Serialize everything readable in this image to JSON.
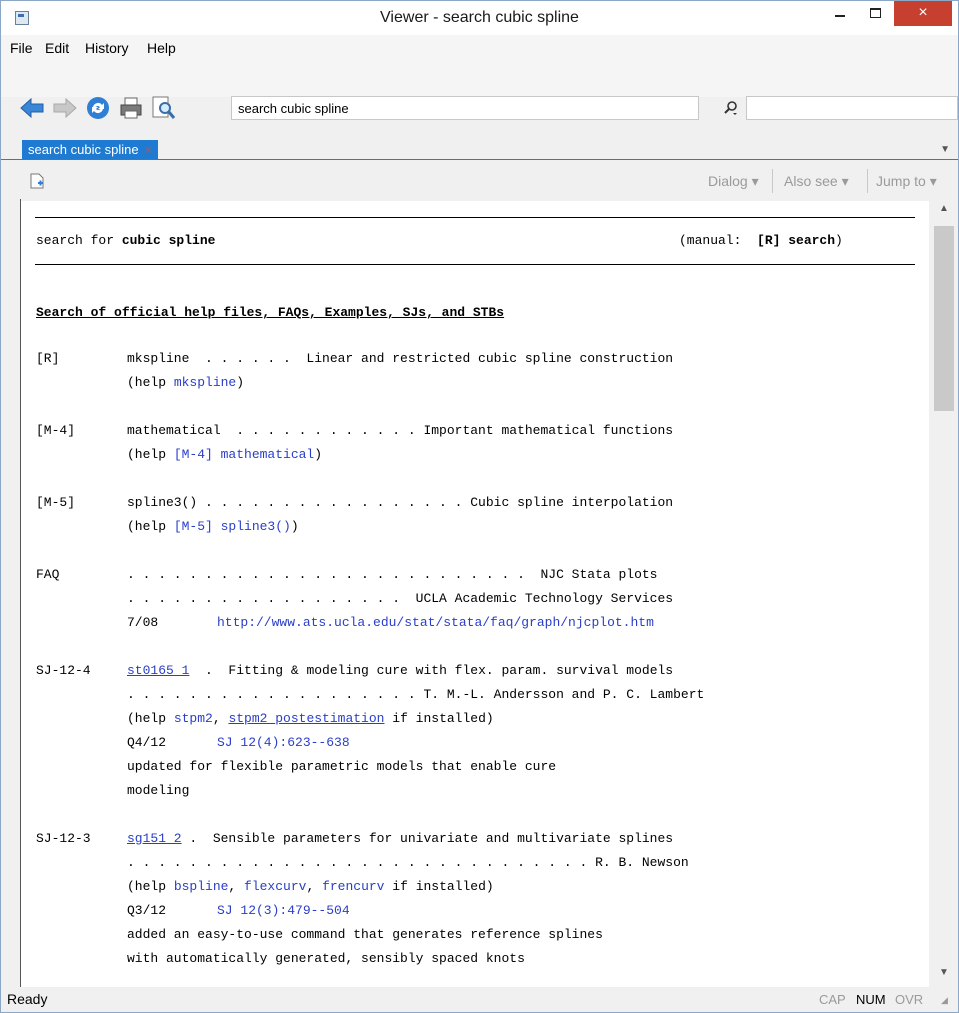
{
  "window": {
    "title": "Viewer - search cubic spline",
    "close_glyph": "×"
  },
  "menu": [
    "File",
    "Edit",
    "History",
    "Help"
  ],
  "toolbar": {
    "search_value": "search cubic spline",
    "find_value": ""
  },
  "tab": {
    "label": "search cubic spline",
    "close_glyph": "×"
  },
  "viewer_toolbar": {
    "dialog": "Dialog ▾",
    "also_see": "Also see ▾",
    "jump_to": "Jump to ▾"
  },
  "content": {
    "header_left": "search for ",
    "header_term": "cubic spline",
    "header_right": "(manual:  [R] search)",
    "section_title": "Search of official help files, FAQs, Examples, SJs, and STBs",
    "entries": {
      "mkspline": {
        "tag": "[R]",
        "line1": "mkspline  . . . . . .  Linear and restricted cubic spline construction",
        "help_prefix": "(help ",
        "help_link": "mkspline",
        "help_suffix": ")"
      },
      "mathematical": {
        "tag": "[M-4]",
        "line1": "mathematical  . . . . . . . . . . . . Important mathematical functions",
        "help_prefix": "(help ",
        "help_link": "[M-4] mathematical",
        "help_suffix": ")"
      },
      "spline3": {
        "tag": "[M-5]",
        "line1": "spline3() . . . . . . . . . . . . . . . . . Cubic spline interpolation",
        "help_prefix": "(help ",
        "help_link": "[M-5] spline3()",
        "help_suffix": ")"
      },
      "faq": {
        "tag": "FAQ",
        "line1": ". . . . . . . . . . . . . . . . . . . . . . . . . .  NJC Stata plots",
        "line2": ". . . . . . . . . . . . . . . . . .  UCLA Academic Technology Services",
        "date": "7/08",
        "url": "http://www.ats.ucla.edu/stat/stata/faq/graph/njcplot.htm"
      },
      "st0165": {
        "tag": "SJ-12-4",
        "link": "st0165_1",
        "line1_rest": "  .  Fitting & modeling cure with flex. param. survival models",
        "line2": ". . . . . . . . . . . . . . . . . . . T. M.-L. Andersson and P. C. Lambert",
        "help_prefix": "(help ",
        "help_link1": "stpm2",
        "help_sep": ", ",
        "help_link2": "stpm2_postestimation",
        "help_suffix": " if installed)",
        "date": "Q4/12",
        "ref": "SJ 12(4):623--638",
        "desc1": "updated for flexible parametric models that enable cure",
        "desc2": "modeling"
      },
      "sg151": {
        "tag": "SJ-12-3",
        "link": "sg151_2",
        "line1_rest": " .  Sensible parameters for univariate and multivariate splines",
        "line2": ". . . . . . . . . . . . . . . . . . . . . . . . . . . . . . R. B. Newson",
        "help_prefix": "(help ",
        "help_link1": "bspline",
        "help_sep1": ", ",
        "help_link2": "flexcurv",
        "help_sep2": ", ",
        "help_link3": "frencurv",
        "help_suffix": " if installed)",
        "date": "Q3/12",
        "ref": "SJ 12(3):479--504",
        "desc1": "added an easy-to-use command that generates reference splines",
        "desc2": "with automatically generated, sensibly spaced knots"
      }
    }
  },
  "status": {
    "text": "Ready",
    "cap": "CAP",
    "num": "NUM",
    "ovr": "OVR"
  },
  "colors": {
    "link": "#2a3ec9",
    "tab": "#1f7bd1",
    "close": "#c7402f"
  },
  "icons": [
    "back-arrow-icon",
    "forward-arrow-icon",
    "refresh-icon",
    "print-icon",
    "search-doc-icon",
    "find-icon",
    "new-viewer-icon"
  ]
}
